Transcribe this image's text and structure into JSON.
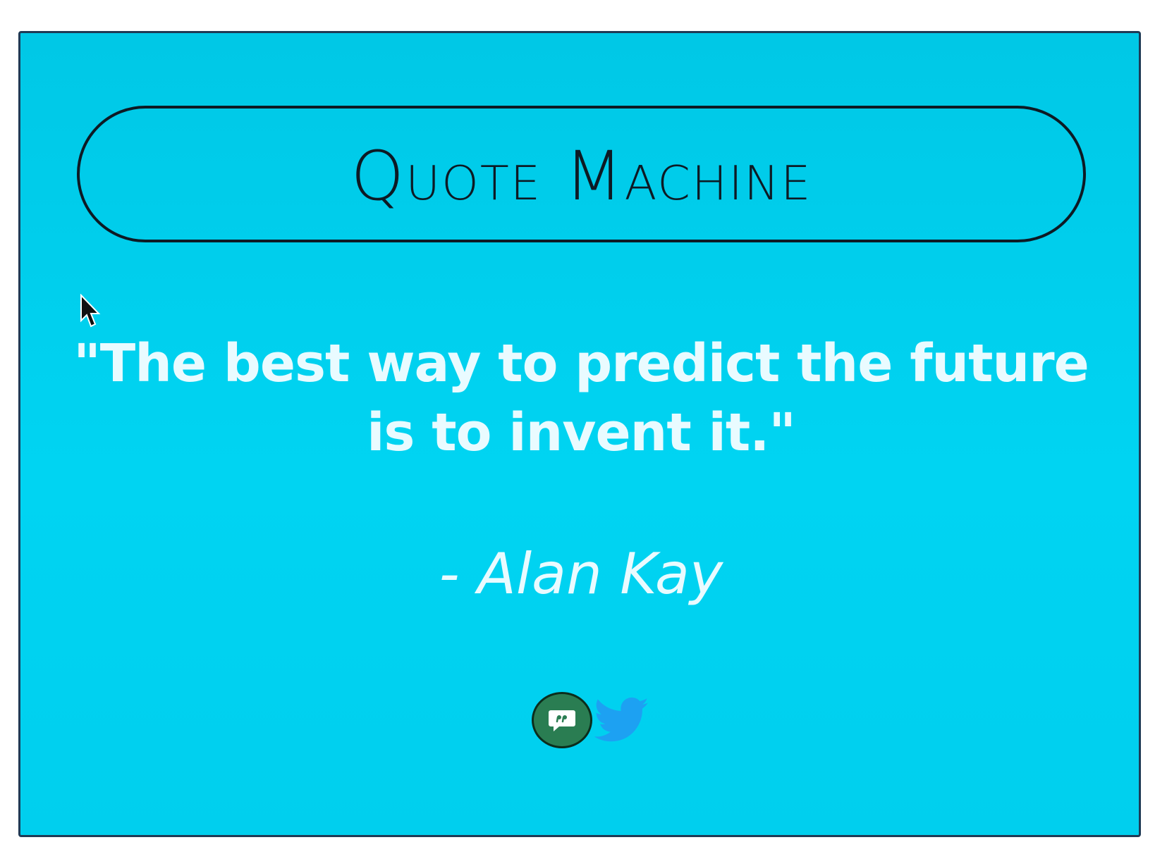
{
  "header": {
    "title": "Quote Machine"
  },
  "quote": {
    "text": "\"The best way to predict the future is to invent it.\"",
    "author": "- Alan Kay"
  },
  "actions": {
    "new_quote_icon": "speech-bubble-quote-icon",
    "tweet_icon": "twitter-bird-icon"
  },
  "colors": {
    "background": "#00d0ee",
    "text": "#e9fbff",
    "title": "#0d1a24",
    "new_quote_button": "#2a7d52",
    "twitter": "#1da1f2"
  }
}
